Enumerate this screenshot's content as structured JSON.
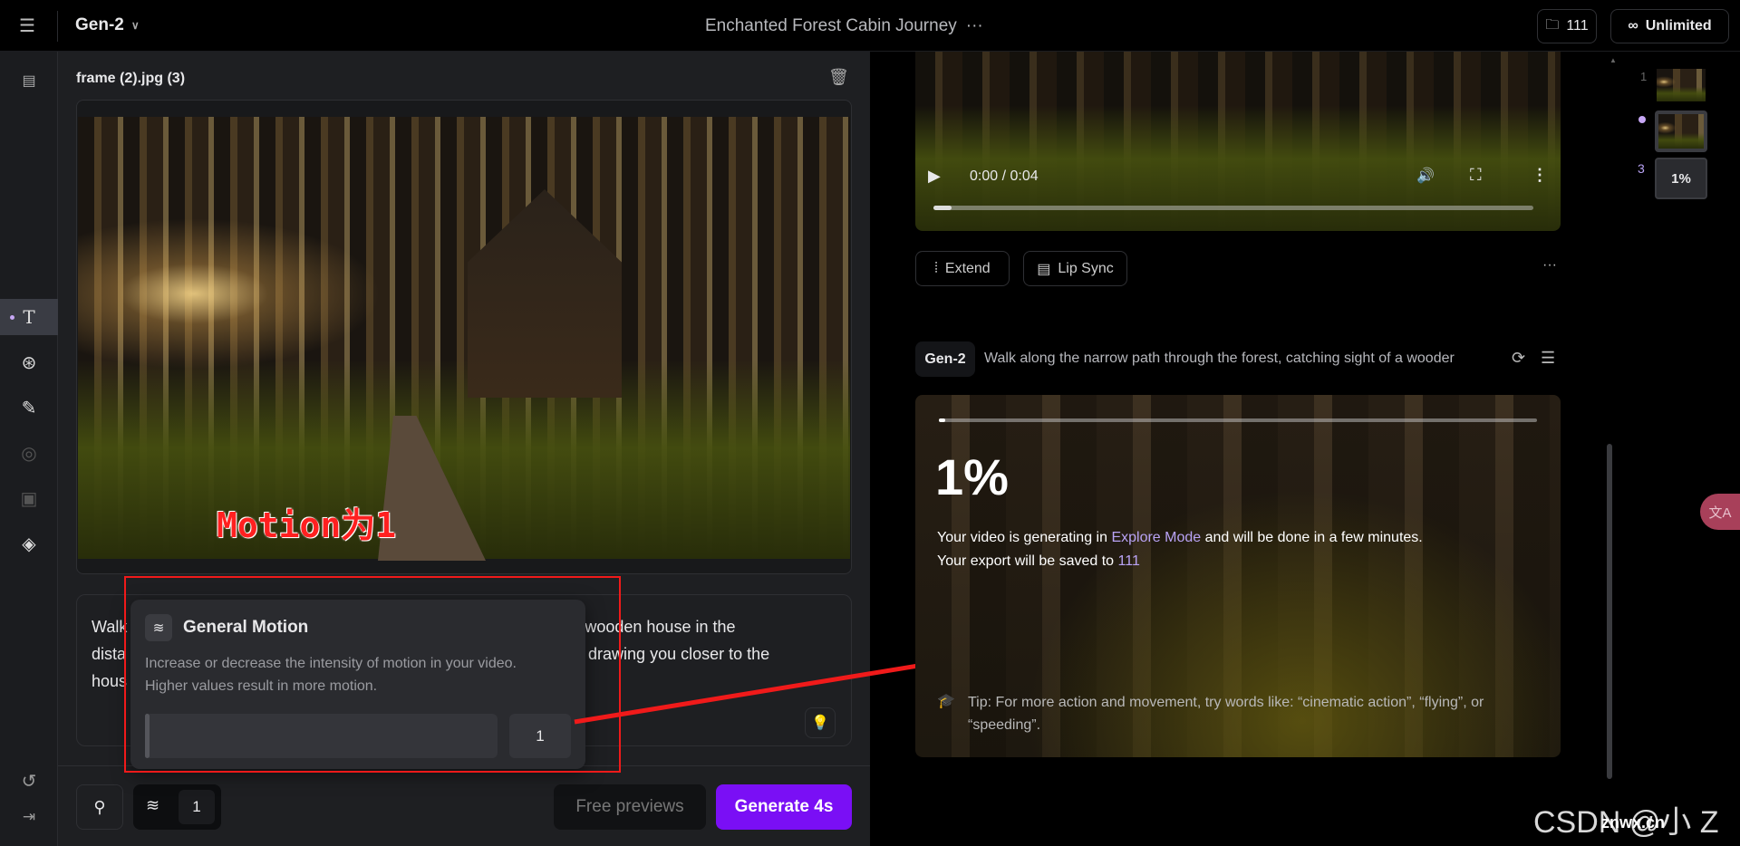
{
  "header": {
    "app": "Gen-2",
    "project_title": "Enchanted Forest Cabin Journey",
    "folder_count": "111",
    "plan": "Unlimited"
  },
  "sidebar": {
    "items": [
      "assets",
      "text",
      "camera",
      "brush",
      "palette",
      "frames",
      "layers",
      "undo",
      "collapse"
    ]
  },
  "editor": {
    "file_name": "frame (2).jpg (3)",
    "prompt_lines": [
      "Walk along the narrow path through the forest, catching sight of a wooden house in the",
      "distance, surrounded by tall trees, drawing you closer to the",
      "house"
    ],
    "prompt_visible": {
      "l1": "Walk",
      "l1r": "f a wooden house in the",
      "l2": "dista",
      "l2r": ", drawing you closer to the",
      "l3": "hous"
    },
    "annotation": "Motion为1",
    "popover": {
      "title": "General Motion",
      "description_1": "Increase or decrease the intensity of motion in your video.",
      "description_2": "Higher values result in more motion.",
      "value": "1",
      "level": 0.01
    },
    "motion_value": "1",
    "free_previews": "Free previews",
    "generate": "Generate 4s"
  },
  "video": {
    "time": "0:00 / 0:04",
    "progress": 0.03,
    "extend": "Extend",
    "lip_sync": "Lip Sync"
  },
  "generation": {
    "model": "Gen-2",
    "prompt": "Walk along the narrow path through the forest, catching sight of a wooder",
    "percent": "1%",
    "progress": 0.01,
    "msg_1a": "Your video is generating in ",
    "msg_1b": "Explore Mode",
    "msg_1c": " and will be done in a few minutes.",
    "msg_2a": "Your export will be saved to ",
    "msg_2b": "111",
    "tip_1": "Tip: For more action and movement, try words like: “cinematic action”, “flying”, or",
    "tip_2": "“speeding”."
  },
  "thumbnails": {
    "n1": "1",
    "n3": "3",
    "pct": "1%"
  },
  "watermark": "CSDN @小 Z",
  "watermark2": "znwx.cn",
  "colors": {
    "accent": "#7a0ff5",
    "link": "#b9a3f5",
    "annotation": "#ff1a1a"
  }
}
